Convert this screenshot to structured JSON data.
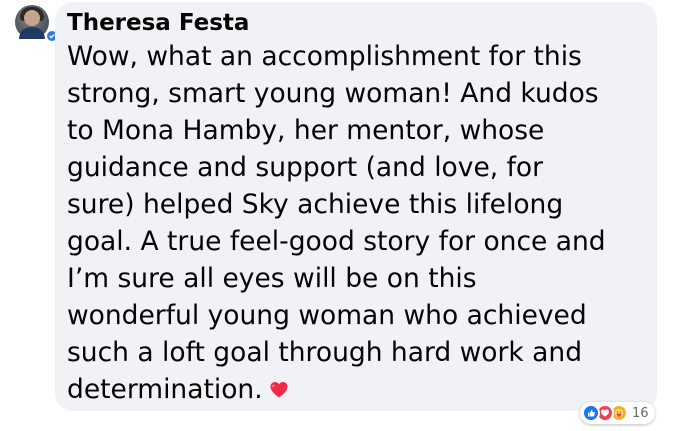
{
  "comment": {
    "author": "Theresa Festa",
    "text_lines": [
      "Wow, what an accomplishment for this",
      "strong, smart young woman! And kudos",
      "to Mona Hamby, her mentor, whose",
      "guidance and support (and love, for",
      "sure) helped Sky achieve this lifelong",
      "goal. A true feel-good story for once and",
      "I’m sure all eyes will be on this",
      "wonderful young woman who achieved",
      "such a loft goal through hard work and",
      "determination."
    ],
    "trailing_emoji": "heart-emoji",
    "reactions": {
      "icons": [
        "like-icon",
        "love-icon",
        "care-icon"
      ],
      "count": "16"
    }
  },
  "colors": {
    "bubble_bg": "#f0f2f5",
    "text": "#050505",
    "like": "#1877f2",
    "love": "#f33e58",
    "care": "#f7b125",
    "heart": "#f02849",
    "count_text": "#65676b"
  }
}
